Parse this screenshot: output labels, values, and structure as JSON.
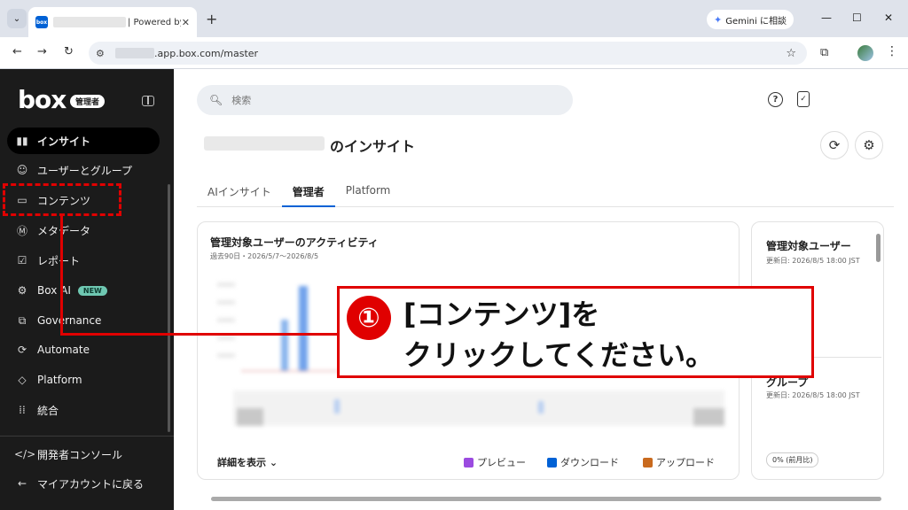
{
  "browser": {
    "tab_title": "| Powered by",
    "favicon_text": "box",
    "close": "✕",
    "new_tab": "+",
    "gemini_label": "Gemini に相談",
    "url": ".app.box.com/master",
    "controls": {
      "minimize": "—",
      "maximize": "☐",
      "close": "✕"
    },
    "nav": {
      "back": "←",
      "forward": "→",
      "reload": "↻"
    }
  },
  "sidebar": {
    "logo": "box",
    "admin_badge": "管理者",
    "items": [
      {
        "label": "インサイト",
        "icon": "▮▮"
      },
      {
        "label": "ユーザーとグループ",
        "icon": "☺"
      },
      {
        "label": "コンテンツ",
        "icon": "▭"
      },
      {
        "label": "メタデータ",
        "icon": "Ⓜ"
      },
      {
        "label": "レポート",
        "icon": "☑"
      },
      {
        "label": "Box AI",
        "icon": "⚙",
        "badge": "NEW"
      },
      {
        "label": "Governance",
        "icon": "⧉"
      },
      {
        "label": "Automate",
        "icon": "⟳"
      },
      {
        "label": "Platform",
        "icon": "◇"
      },
      {
        "label": "統合",
        "icon": "⁞⁞"
      }
    ],
    "bottom_items": [
      {
        "label": "開発者コンソール",
        "icon": "</>"
      },
      {
        "label": "マイアカウントに戻る",
        "icon": "←"
      }
    ]
  },
  "main": {
    "search_placeholder": "検索",
    "page_title_suffix": "のインサイト",
    "tabs": [
      "AIインサイト",
      "管理者",
      "Platform"
    ],
    "activity_card": {
      "title": "管理対象ユーザーのアクティビティ",
      "subtitle": "過去90日・2026/5/7〜2026/8/5",
      "details": "詳細を表示 ⌄",
      "legend": [
        {
          "label": "プレビュー",
          "color": "#9b4be0"
        },
        {
          "label": "ダウンロード",
          "color": "#0061d5"
        },
        {
          "label": "アップロード",
          "color": "#c96a1e"
        }
      ]
    },
    "side_card": {
      "title": "管理対象ユーザー",
      "updated": "更新日: 2026/8/5 18:00 JST",
      "title2": "グループ",
      "updated2": "更新日: 2026/8/5 18:00 JST",
      "pct": "0% (前月比)"
    }
  },
  "annotation": {
    "number": "①",
    "line1": "[コンテンツ]を",
    "line2": "クリックしてください。",
    "color": "#e00000"
  }
}
